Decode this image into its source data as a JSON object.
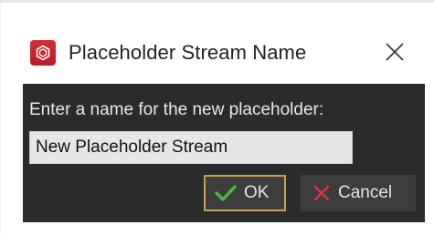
{
  "dialog": {
    "title": "Placeholder Stream Name",
    "app_icon": "app-logo-icon",
    "close_icon": "close-icon"
  },
  "body": {
    "prompt": "Enter a name for the new placeholder:",
    "input_value": "New Placeholder Stream"
  },
  "buttons": {
    "ok_label": "OK",
    "ok_icon": "checkmark-icon",
    "cancel_label": "Cancel",
    "cancel_icon": "x-icon"
  },
  "colors": {
    "dialog_bg": "#2b2b2b",
    "accent_border": "#c9a050",
    "ok_check": "#3fbf3f",
    "cancel_x": "#d9363e",
    "app_icon": "#c62834"
  }
}
